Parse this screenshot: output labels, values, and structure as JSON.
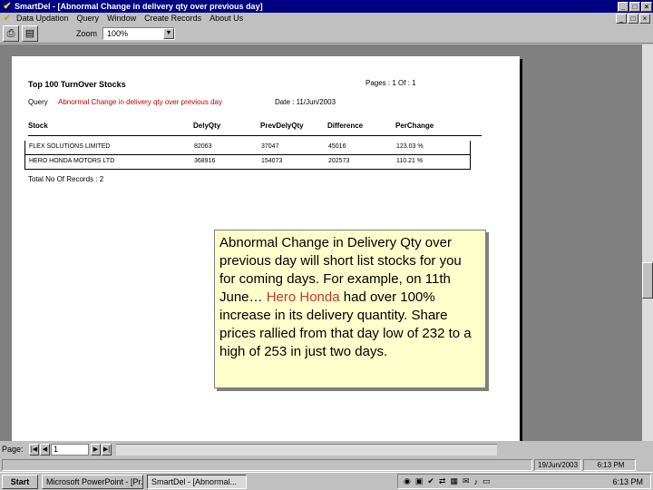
{
  "window": {
    "title": "SmartDel - [Abnormal Change in delivery qty over previous day]",
    "controls": [
      "_",
      "□",
      "×"
    ]
  },
  "menu": {
    "items": [
      "Data Updation",
      "Query",
      "Window",
      "Create Records",
      "About Us"
    ],
    "doc_controls": [
      "_",
      "□",
      "×"
    ]
  },
  "toolbar": {
    "zoom_label": "Zoom",
    "zoom_value": "100%"
  },
  "report": {
    "title": "Top 100 TurnOver Stocks",
    "page_info": "Pages :   1          Of :   1",
    "query_label": "Query",
    "query_text": "Abnormal Change in delivery qty over previous day",
    "date_info": "Date :  11/Jun/2003",
    "columns": [
      "Stock",
      "DelyQty",
      "PrevDelyQty",
      "Difference",
      "PerChange"
    ],
    "rows": [
      [
        "FLEX SOLUTIONS LIMITED",
        "82063",
        "37047",
        "45016",
        "123.03 %"
      ],
      [
        "HERO HONDA MOTORS LTD",
        "368916",
        "154073",
        "202573",
        "110.21 %"
      ]
    ],
    "total": "Total No Of Records :    2"
  },
  "callout": {
    "line_1": "Abnormal Change in Delivery Qty over previous day will short list stocks for you for coming days. For example, on 11th June… ",
    "highlight": "Hero Honda",
    "line_2": " had over 100% increase in its delivery quantity. Share prices rallied from that day low of 232 to a high of 253 in just two days."
  },
  "pagebar": {
    "label": "Page:",
    "page_value": "1"
  },
  "status": {
    "date": "19/Jun/2003",
    "time": "6:13 PM"
  },
  "taskbar": {
    "start": "Start",
    "task_1": "Microsoft PowerPoint - [Pr...",
    "task_2": "SmartDel - [Abnormal...",
    "clock": "6:13 PM"
  }
}
